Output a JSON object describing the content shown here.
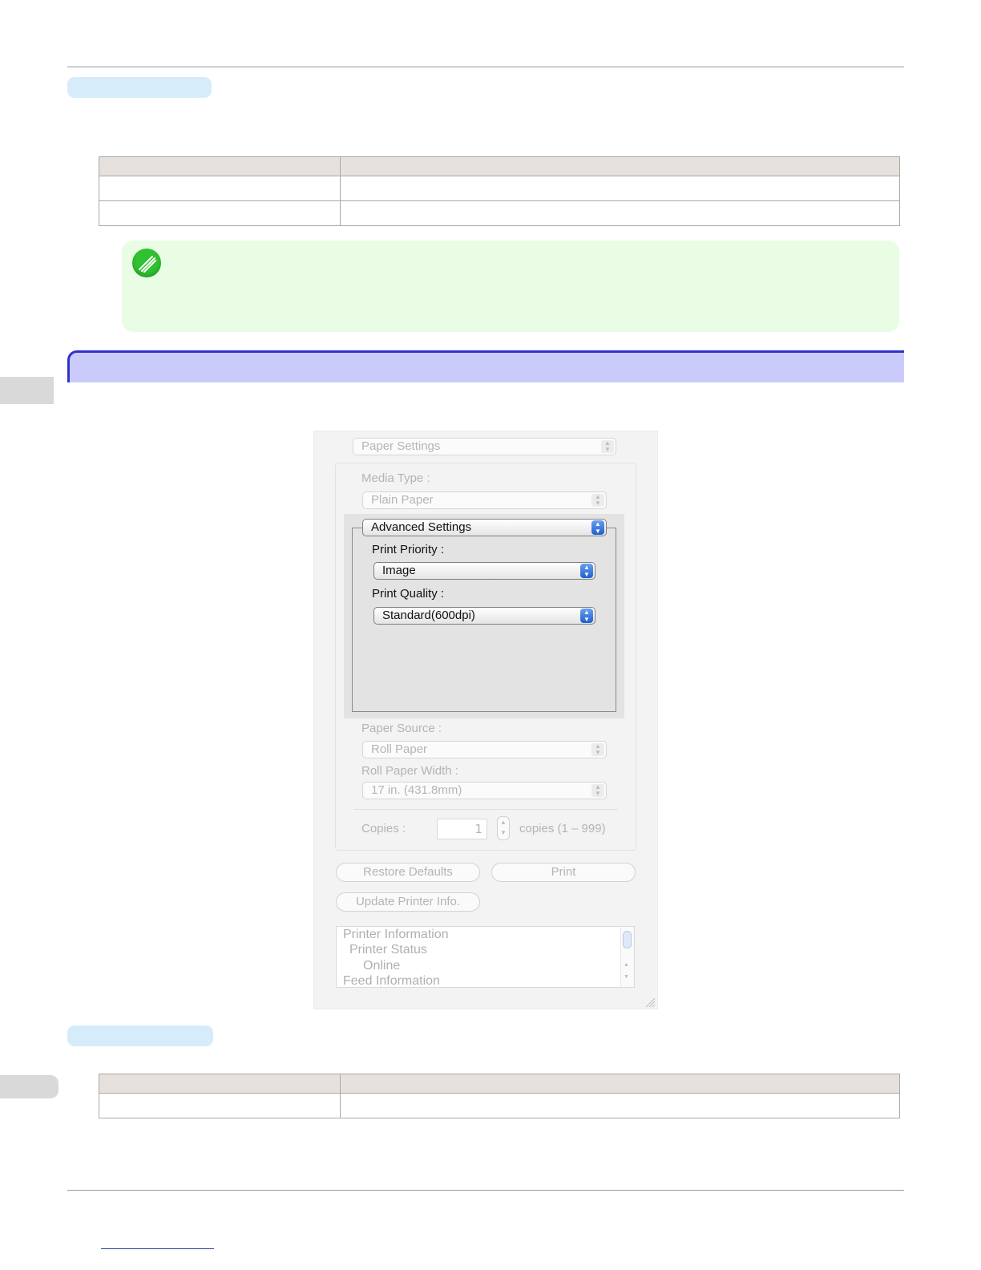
{
  "dialog": {
    "panel_menu": "Paper Settings",
    "media_type_label": "Media Type :",
    "media_type_value": "Plain Paper",
    "advanced_menu": "Advanced Settings",
    "print_priority_label": "Print Priority :",
    "print_priority_value": "Image",
    "print_quality_label": "Print Quality :",
    "print_quality_value": "Standard(600dpi)",
    "paper_source_label": "Paper Source :",
    "paper_source_value": "Roll Paper",
    "roll_width_label": "Roll Paper Width :",
    "roll_width_value": "17 in. (431.8mm)",
    "copies_label": "Copies :",
    "copies_value": "1",
    "copies_range": "copies (1 – 999)",
    "restore_defaults": "Restore Defaults",
    "print_button": "Print",
    "update_printer_info": "Update Printer Info.",
    "info_lines": [
      "Printer Information",
      "Printer Status",
      "Online",
      "Feed Information"
    ],
    "arrow_up": "▲",
    "arrow_down": "▼"
  },
  "icons": {
    "note": "note-pencil-icon",
    "resize": "resize-grip-icon"
  },
  "colors": {
    "pill": "#d6ecfb",
    "table_header": "#e6e1dc",
    "note_bg": "#e8fde4",
    "note_icon": "#2fc12f",
    "banner_bg": "#cbcbfb",
    "banner_border": "#3131cc"
  }
}
